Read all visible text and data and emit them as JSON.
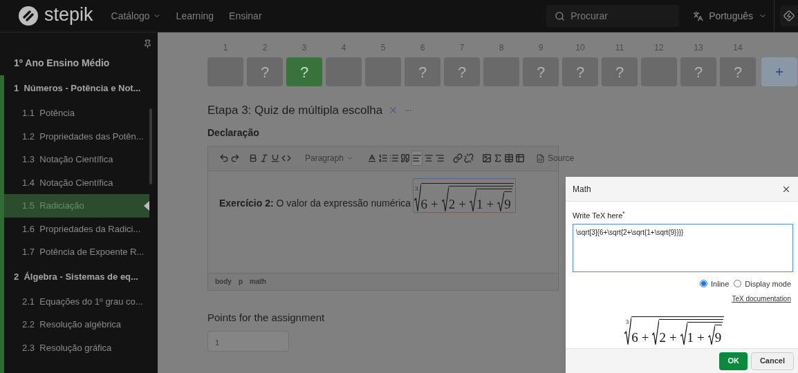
{
  "nav": {
    "logo": "stepik",
    "links": [
      {
        "label": "Catálogo",
        "dropdown": true
      },
      {
        "label": "Learning",
        "dropdown": false
      },
      {
        "label": "Ensinar",
        "dropdown": false
      }
    ],
    "search": {
      "placeholder": "Procurar"
    },
    "language": "Português"
  },
  "sidebar": {
    "title": "1º Ano Ensino Médio",
    "sections": [
      {
        "label": "1  Números - Potência e Not...",
        "children": [
          {
            "label": "1.1  Potência",
            "selected": false
          },
          {
            "label": "1.2  Propriedades das Potên...",
            "selected": false
          },
          {
            "label": "1.3  Notação Científica",
            "selected": false
          },
          {
            "label": "1.4  Notação Científica",
            "selected": false
          },
          {
            "label": "1.5  Radiciação",
            "selected": true
          },
          {
            "label": "1.6  Propriedades da Radici...",
            "selected": false
          },
          {
            "label": "1.7  Potência de Expoente R...",
            "selected": false
          }
        ]
      },
      {
        "label": "2  Álgebra - Sistemas de eq...",
        "children": [
          {
            "label": "2.1  Equações do 1º grau co...",
            "selected": false
          },
          {
            "label": "2.2  Resolução algébrica",
            "selected": false
          },
          {
            "label": "2.3  Resolução gráfica",
            "selected": false
          }
        ]
      }
    ]
  },
  "steps": [
    {
      "number": "1",
      "selected": false
    },
    {
      "number": "2",
      "mark": "?",
      "selected": false
    },
    {
      "number": "3",
      "mark": "?",
      "selected": true
    },
    {
      "number": "4",
      "selected": false
    },
    {
      "number": "5",
      "selected": false
    },
    {
      "number": "6",
      "mark": "?",
      "selected": false
    },
    {
      "number": "7",
      "mark": "?",
      "selected": false
    },
    {
      "number": "8",
      "selected": false
    },
    {
      "number": "9",
      "mark": "?",
      "selected": false
    },
    {
      "number": "10",
      "mark": "?",
      "selected": false
    },
    {
      "number": "11",
      "mark": "?",
      "selected": false
    },
    {
      "number": "12",
      "selected": false
    },
    {
      "number": "13",
      "mark": "?",
      "selected": false
    },
    {
      "number": "14",
      "mark": "?",
      "selected": false
    }
  ],
  "step_title": "Etapa 3: Quiz de múltipla escolha",
  "statement_label": "Declaração",
  "toolbar": [
    {
      "kind": "undo",
      "selected": false
    },
    {
      "kind": "redo",
      "selected": false
    },
    {
      "kind": "sep"
    },
    {
      "kind": "bold",
      "selected": false
    },
    {
      "kind": "italic",
      "selected": false
    },
    {
      "kind": "underline",
      "selected": false
    },
    {
      "kind": "code",
      "selected": false
    },
    {
      "kind": "sep"
    },
    {
      "kind": "dropdown",
      "label": "Paragraph"
    },
    {
      "kind": "sep"
    },
    {
      "kind": "color",
      "selected": false
    },
    {
      "kind": "ordered-list",
      "selected": false
    },
    {
      "kind": "bullet-list",
      "selected": false
    },
    {
      "kind": "quote",
      "selected": false
    },
    {
      "kind": "align-left",
      "selected": true
    },
    {
      "kind": "align-center",
      "selected": false
    },
    {
      "kind": "align-right",
      "selected": false
    },
    {
      "kind": "sep"
    },
    {
      "kind": "link",
      "selected": false
    },
    {
      "kind": "unlink",
      "selected": false
    },
    {
      "kind": "sep"
    },
    {
      "kind": "image",
      "selected": false
    },
    {
      "kind": "sigma",
      "selected": false
    },
    {
      "kind": "table",
      "selected": false
    },
    {
      "kind": "table-alt",
      "selected": false
    },
    {
      "kind": "sep"
    },
    {
      "kind": "source",
      "label": "Source"
    }
  ],
  "editor": {
    "text": "**Exercício 2:** O valor da expressão numérica",
    "formula": {
      "index": "3",
      "terms": [
        "6",
        "+",
        {
          "terms": [
            "2",
            "+",
            {
              "terms": [
                "1",
                "+",
                {
                  "terms": [
                    "9"
                  ]
                }
              ]
            }
          ]
        }
      ]
    },
    "path": [
      "body",
      "p",
      "math"
    ]
  },
  "points": {
    "label": "Points for the assignment",
    "value": "1"
  },
  "dialog": {
    "title": "Math",
    "field_label": "Write TeX here",
    "required_mark": "*",
    "input_value": "\\sqrt[3]{6+\\sqrt{2+\\sqrt{1+\\sqrt{9}}}}",
    "modes": [
      {
        "label": "Inline",
        "selected": true
      },
      {
        "label": "Display mode",
        "selected": false
      }
    ],
    "doc_link": "TeX documentation",
    "preview": {
      "index": "3",
      "terms": [
        "6",
        "+",
        {
          "terms": [
            "2",
            "+",
            {
              "terms": [
                "1",
                "+",
                {
                  "terms": [
                    "9"
                  ]
                }
              ]
            }
          ]
        }
      ]
    },
    "buttons": [
      {
        "label": "OK",
        "kind": "primary"
      },
      {
        "label": "Cancel",
        "kind": "secondary"
      }
    ]
  }
}
